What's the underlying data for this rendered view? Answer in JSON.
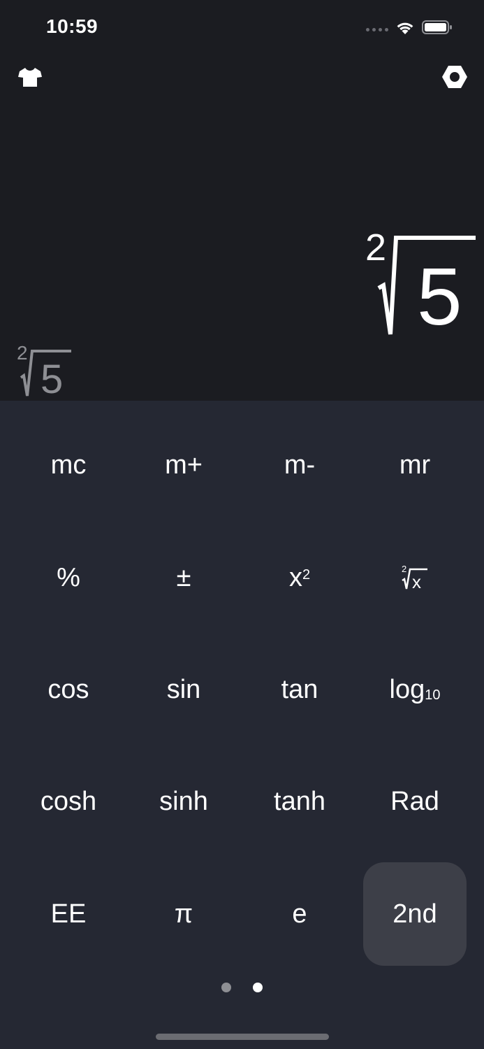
{
  "status_bar": {
    "time": "10:59"
  },
  "toolbar": {
    "left_icon": "tshirt-icon",
    "right_icon": "hexagon-nut-icon"
  },
  "display": {
    "main": {
      "index": "2",
      "radicand": "5"
    },
    "history": {
      "index": "2",
      "radicand": "5"
    }
  },
  "keypad": {
    "rows": [
      [
        {
          "label": "mc"
        },
        {
          "label": "m+"
        },
        {
          "label": "m-"
        },
        {
          "label": "mr"
        }
      ],
      [
        {
          "label": "%"
        },
        {
          "label": "±"
        },
        {
          "label": "x",
          "sup": "2"
        },
        {
          "label": "x",
          "root_index": "2"
        }
      ],
      [
        {
          "label": "cos"
        },
        {
          "label": "sin"
        },
        {
          "label": "tan"
        },
        {
          "label": "log",
          "sub": "10"
        }
      ],
      [
        {
          "label": "cosh"
        },
        {
          "label": "sinh"
        },
        {
          "label": "tanh"
        },
        {
          "label": "Rad"
        }
      ],
      [
        {
          "label": "EE"
        },
        {
          "label": "π"
        },
        {
          "label": "e"
        },
        {
          "label": "2nd",
          "active": true
        }
      ]
    ]
  },
  "pagination": {
    "pages": 2,
    "current": 2
  },
  "colors": {
    "display_bg": "#1b1c21",
    "keypad_bg": "#252833",
    "active_key_bg": "#3d3f48",
    "history_text": "#8e8f94",
    "dot_inactive": "#8e8f94",
    "dot_active": "#ffffff"
  }
}
